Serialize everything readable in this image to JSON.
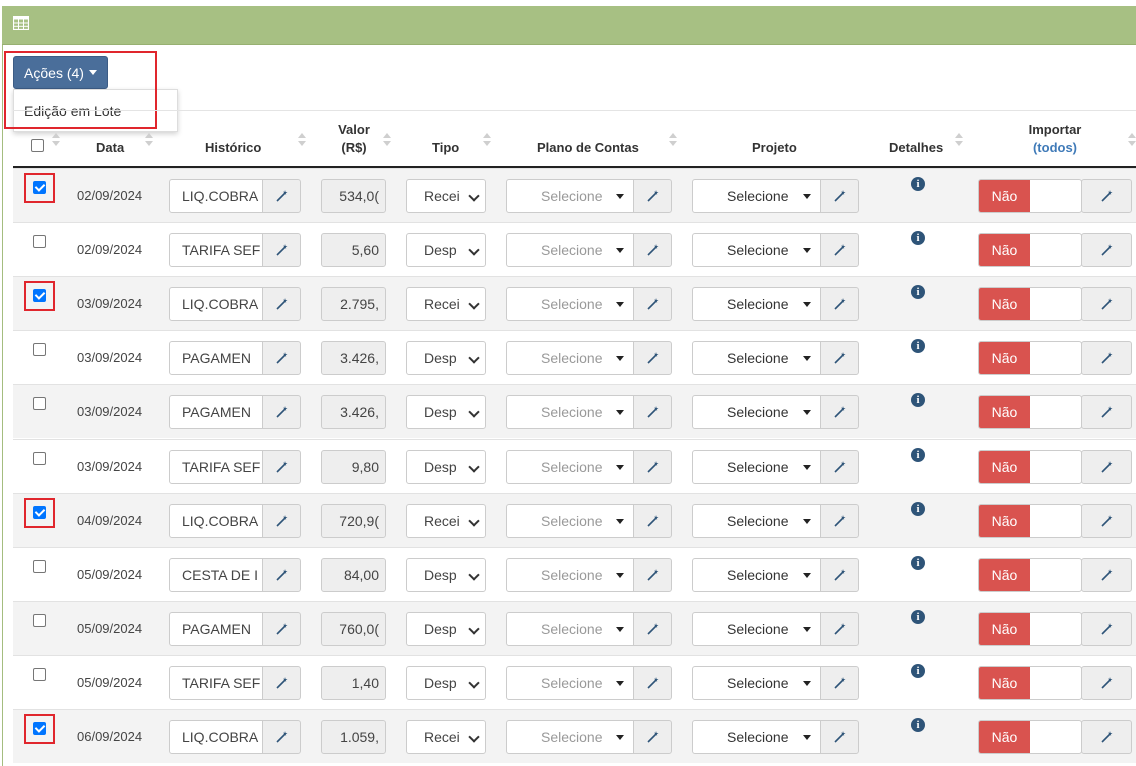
{
  "actions": {
    "button_label": "Ações (4)",
    "menu_items": [
      "Edição em Lote"
    ]
  },
  "table": {
    "headers": {
      "data": "Data",
      "historico": "Histórico",
      "valor_line1": "Valor",
      "valor_line2": "(R$)",
      "tipo": "Tipo",
      "plano": "Plano de Contas",
      "projeto": "Projeto",
      "detalhes": "Detalhes",
      "importar": "Importar",
      "importar_link": "(todos)"
    },
    "select_placeholder": "Selecione",
    "toggle_off_label": "Não",
    "rows": [
      {
        "checked": true,
        "date": "02/09/2024",
        "historico": "LIQ.COBRA",
        "valor": "534,0(",
        "tipo": "Recei"
      },
      {
        "checked": false,
        "date": "02/09/2024",
        "historico": "TARIFA SEF",
        "valor": "5,60",
        "tipo": "Desp"
      },
      {
        "checked": true,
        "date": "03/09/2024",
        "historico": "LIQ.COBRA",
        "valor": "2.795,",
        "tipo": "Recei"
      },
      {
        "checked": false,
        "date": "03/09/2024",
        "historico": "PAGAMEN",
        "valor": "3.426,",
        "tipo": "Desp"
      },
      {
        "checked": false,
        "date": "03/09/2024",
        "historico": "PAGAMEN",
        "valor": "3.426,",
        "tipo": "Desp"
      },
      {
        "checked": false,
        "date": "03/09/2024",
        "historico": "TARIFA SEF",
        "valor": "9,80",
        "tipo": "Desp"
      },
      {
        "checked": true,
        "date": "04/09/2024",
        "historico": "LIQ.COBRA",
        "valor": "720,9(",
        "tipo": "Recei"
      },
      {
        "checked": false,
        "date": "05/09/2024",
        "historico": "CESTA DE I",
        "valor": "84,00",
        "tipo": "Desp"
      },
      {
        "checked": false,
        "date": "05/09/2024",
        "historico": "PAGAMEN",
        "valor": "760,0(",
        "tipo": "Desp"
      },
      {
        "checked": false,
        "date": "05/09/2024",
        "historico": "TARIFA SEF",
        "valor": "1,40",
        "tipo": "Desp"
      },
      {
        "checked": true,
        "date": "06/09/2024",
        "historico": "LIQ.COBRA",
        "valor": "1.059,",
        "tipo": "Recei"
      }
    ]
  },
  "colors": {
    "header_bar": "#a7c083",
    "primary_button": "#4a6e9a",
    "toggle_off": "#d9534f",
    "highlight": "#e0262d",
    "link": "#3f7ab8"
  }
}
